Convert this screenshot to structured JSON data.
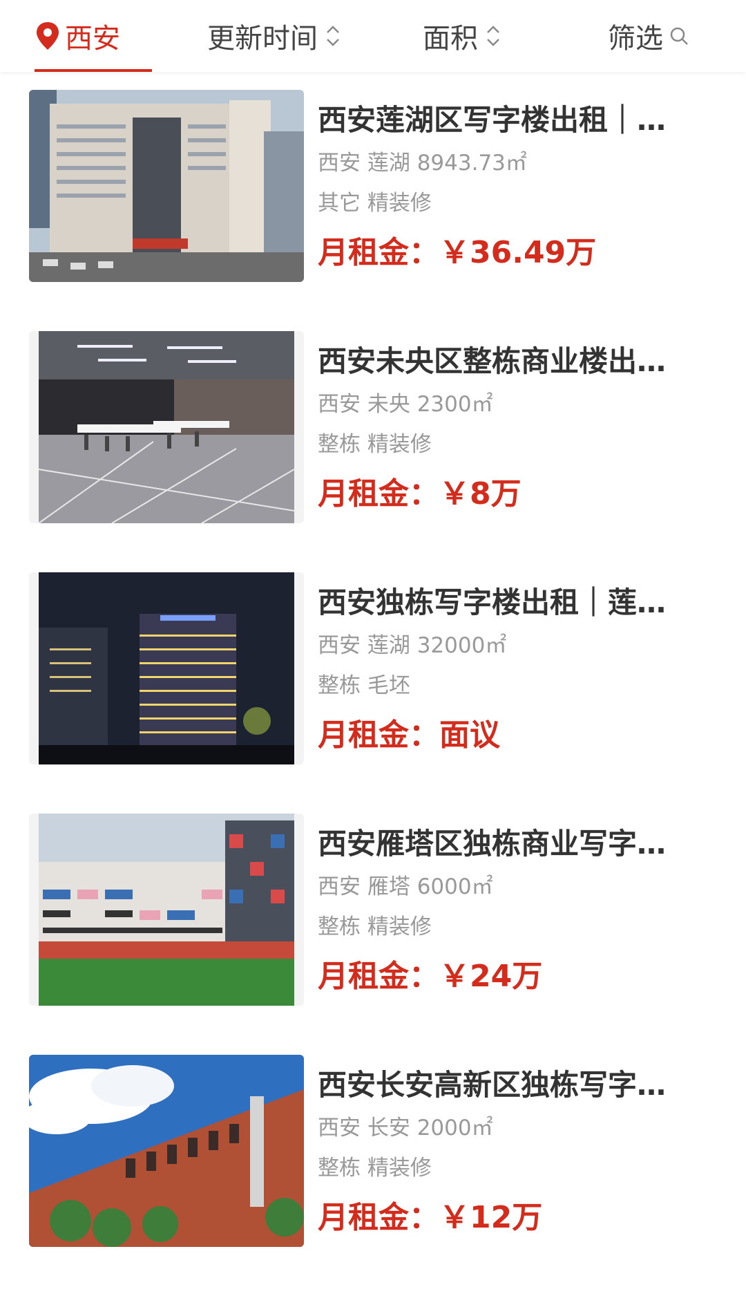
{
  "header": {
    "city": "西安",
    "sort_time": "更新时间",
    "sort_area": "面积",
    "filter": "筛选"
  },
  "colors": {
    "accent": "#d42c1c",
    "text": "#333333",
    "muted": "#999999"
  },
  "price_prefix": "月租金：",
  "listings": [
    {
      "title": "西安莲湖区写字楼出租｜…",
      "location": "西安 莲湖 8943.73㎡",
      "tags": "其它 精装修",
      "price": "￥36.49万"
    },
    {
      "title": "西安未央区整栋商业楼出…",
      "location": "西安 未央 2300㎡",
      "tags": "整栋 精装修",
      "price": "￥8万"
    },
    {
      "title": "西安独栋写字楼出租｜莲…",
      "location": "西安 莲湖 32000㎡",
      "tags": "整栋 毛坯",
      "price": "面议"
    },
    {
      "title": "西安雁塔区独栋商业写字…",
      "location": "西安 雁塔 6000㎡",
      "tags": "整栋 精装修",
      "price": "￥24万"
    },
    {
      "title": "西安长安高新区独栋写字…",
      "location": "西安 长安 2000㎡",
      "tags": "整栋 精装修",
      "price": "￥12万"
    }
  ]
}
